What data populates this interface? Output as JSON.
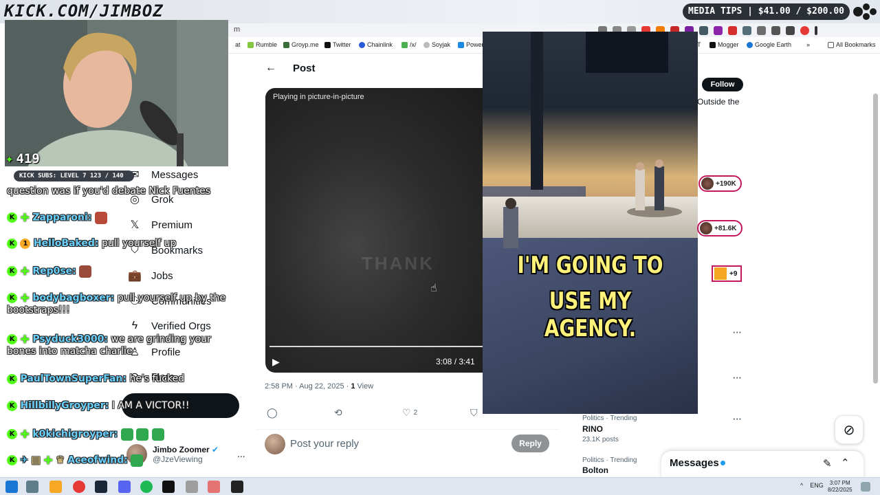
{
  "stream": {
    "brand": "KICK.COM/JIMBOZ",
    "tips": "MEDIA TIPS | $41.00 / $200.00",
    "viewers": "419",
    "subs_goal": "KICK SUBS: LEVEL 7 123 / 140"
  },
  "browser": {
    "url_tail": "m",
    "bookmarks": [
      "at",
      "Rumble",
      "Groyp.me",
      "Twitter",
      "Chainlink",
      "/x/",
      "Soyjak",
      "Power",
      "T",
      "Mogger",
      "Google Earth",
      "All Bookmarks"
    ]
  },
  "chat": [
    {
      "user": "",
      "text": "question was if you'd debate Nick Fuentes"
    },
    {
      "user": "Zapparoni:",
      "text": ""
    },
    {
      "user": "HelloBaked:",
      "text": "pull yourself up"
    },
    {
      "user": "Rep0se:",
      "text": ""
    },
    {
      "user": "bodybagboxer:",
      "text": "pull yourself up by the bootstraps!!!"
    },
    {
      "user": "Psyduck3000:",
      "text": "we are grinding your bones into matcha charlie"
    },
    {
      "user": "PaulTownSuperFan:",
      "text": "he's fucked"
    },
    {
      "user": "HillbillyGroyper:",
      "text": "I AM A VICTOR!!"
    },
    {
      "user": "k0kichigroyper:",
      "text": ""
    },
    {
      "user": "Aceofwind:",
      "text": ""
    }
  ],
  "nav": {
    "items": [
      "Messages",
      "Grok",
      "Premium",
      "Bookmarks",
      "Jobs",
      "Communities",
      "Verified Orgs",
      "Profile",
      "More"
    ],
    "profile_name": "Jimbo Zoomer",
    "profile_handle": "@JzeViewing",
    "more": "..."
  },
  "post": {
    "header_title": "Post",
    "back_icon": "←",
    "pip_label": "Playing in picture-in-picture",
    "time": "3:08 / 3:41",
    "timestamp": "2:58 PM · Aug 22, 2025 · ",
    "views_count": "1",
    "views_label": " View",
    "likes": "2",
    "reply_placeholder": "Post your reply",
    "reply_button": "Reply",
    "watermark": "THANK"
  },
  "pip": {
    "caption_line1": "I'M GOING TO",
    "caption_line2": "USE MY AGENCY."
  },
  "sidebar": {
    "follow": "Follow",
    "outside": "Outside the",
    "pill1": "+190K",
    "pill2": "+81.6K",
    "pill3": "+9",
    "trends": [
      {
        "category": "Politics · Trending",
        "name": "RINO",
        "count": "23.1K posts"
      },
      {
        "category": "Politics · Trending",
        "name": "Bolton",
        "count": ""
      }
    ],
    "messages": "Messages"
  },
  "taskbar": {
    "lang": "ENG",
    "time": "3:07 PM",
    "date": "8/22/2025"
  },
  "colors": {
    "kick_green": "#53fc18",
    "caption_yellow": "#fff27a",
    "pill_border": "#c2185b"
  }
}
